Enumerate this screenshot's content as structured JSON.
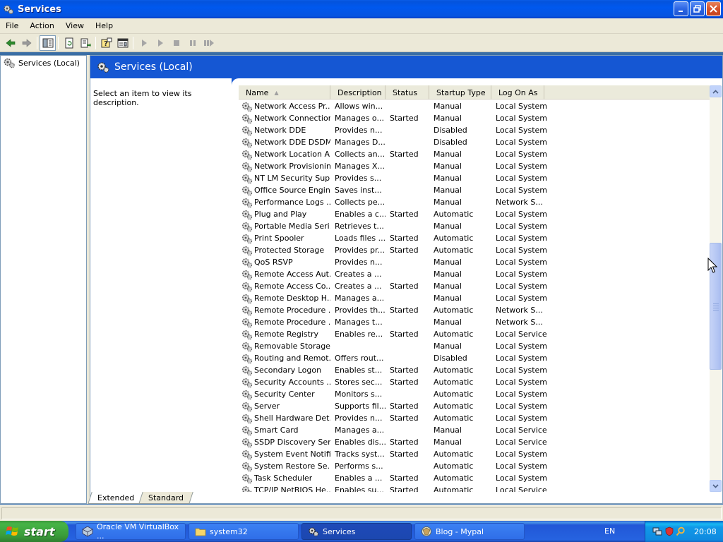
{
  "window": {
    "title": "Services"
  },
  "menu": [
    "File",
    "Action",
    "View",
    "Help"
  ],
  "tree": {
    "root_label": "Services (Local)"
  },
  "header": {
    "title": "Services (Local)"
  },
  "description_prompt": "Select an item to view its description.",
  "columns": {
    "name": "Name",
    "description": "Description",
    "status": "Status",
    "startup": "Startup Type",
    "logon": "Log On As"
  },
  "services": [
    {
      "name": "Network Access Pr...",
      "desc": "Allows win...",
      "status": "",
      "startup": "Manual",
      "logon": "Local System"
    },
    {
      "name": "Network Connections",
      "desc": "Manages o...",
      "status": "Started",
      "startup": "Manual",
      "logon": "Local System"
    },
    {
      "name": "Network DDE",
      "desc": "Provides n...",
      "status": "",
      "startup": "Disabled",
      "logon": "Local System"
    },
    {
      "name": "Network DDE DSDM",
      "desc": "Manages D...",
      "status": "",
      "startup": "Disabled",
      "logon": "Local System"
    },
    {
      "name": "Network Location A...",
      "desc": "Collects an...",
      "status": "Started",
      "startup": "Manual",
      "logon": "Local System"
    },
    {
      "name": "Network Provisionin...",
      "desc": "Manages X...",
      "status": "",
      "startup": "Manual",
      "logon": "Local System"
    },
    {
      "name": "NT LM Security Sup...",
      "desc": "Provides s...",
      "status": "",
      "startup": "Manual",
      "logon": "Local System"
    },
    {
      "name": "Office Source Engine",
      "desc": "Saves inst...",
      "status": "",
      "startup": "Manual",
      "logon": "Local System"
    },
    {
      "name": "Performance Logs ...",
      "desc": "Collects pe...",
      "status": "",
      "startup": "Manual",
      "logon": "Network S..."
    },
    {
      "name": "Plug and Play",
      "desc": "Enables a c...",
      "status": "Started",
      "startup": "Automatic",
      "logon": "Local System"
    },
    {
      "name": "Portable Media Seri...",
      "desc": "Retrieves t...",
      "status": "",
      "startup": "Manual",
      "logon": "Local System"
    },
    {
      "name": "Print Spooler",
      "desc": "Loads files ...",
      "status": "Started",
      "startup": "Automatic",
      "logon": "Local System"
    },
    {
      "name": "Protected Storage",
      "desc": "Provides pr...",
      "status": "Started",
      "startup": "Automatic",
      "logon": "Local System"
    },
    {
      "name": "QoS RSVP",
      "desc": "Provides n...",
      "status": "",
      "startup": "Manual",
      "logon": "Local System"
    },
    {
      "name": "Remote Access Aut...",
      "desc": "Creates a ...",
      "status": "",
      "startup": "Manual",
      "logon": "Local System"
    },
    {
      "name": "Remote Access Co...",
      "desc": "Creates a ...",
      "status": "Started",
      "startup": "Manual",
      "logon": "Local System"
    },
    {
      "name": "Remote Desktop H...",
      "desc": "Manages a...",
      "status": "",
      "startup": "Manual",
      "logon": "Local System"
    },
    {
      "name": "Remote Procedure ...",
      "desc": "Provides th...",
      "status": "Started",
      "startup": "Automatic",
      "logon": "Network S..."
    },
    {
      "name": "Remote Procedure ...",
      "desc": "Manages t...",
      "status": "",
      "startup": "Manual",
      "logon": "Network S..."
    },
    {
      "name": "Remote Registry",
      "desc": "Enables re...",
      "status": "Started",
      "startup": "Automatic",
      "logon": "Local Service"
    },
    {
      "name": "Removable Storage",
      "desc": "",
      "status": "",
      "startup": "Manual",
      "logon": "Local System"
    },
    {
      "name": "Routing and Remot...",
      "desc": "Offers rout...",
      "status": "",
      "startup": "Disabled",
      "logon": "Local System"
    },
    {
      "name": "Secondary Logon",
      "desc": "Enables st...",
      "status": "Started",
      "startup": "Automatic",
      "logon": "Local System"
    },
    {
      "name": "Security Accounts ...",
      "desc": "Stores sec...",
      "status": "Started",
      "startup": "Automatic",
      "logon": "Local System"
    },
    {
      "name": "Security Center",
      "desc": "Monitors s...",
      "status": "",
      "startup": "Automatic",
      "logon": "Local System"
    },
    {
      "name": "Server",
      "desc": "Supports fil...",
      "status": "Started",
      "startup": "Automatic",
      "logon": "Local System"
    },
    {
      "name": "Shell Hardware Det...",
      "desc": "Provides n...",
      "status": "Started",
      "startup": "Automatic",
      "logon": "Local System"
    },
    {
      "name": "Smart Card",
      "desc": "Manages a...",
      "status": "",
      "startup": "Manual",
      "logon": "Local Service"
    },
    {
      "name": "SSDP Discovery Ser...",
      "desc": "Enables dis...",
      "status": "Started",
      "startup": "Manual",
      "logon": "Local Service"
    },
    {
      "name": "System Event Notifi...",
      "desc": "Tracks syst...",
      "status": "Started",
      "startup": "Automatic",
      "logon": "Local System"
    },
    {
      "name": "System Restore Se...",
      "desc": "Performs s...",
      "status": "",
      "startup": "Automatic",
      "logon": "Local System"
    },
    {
      "name": "Task Scheduler",
      "desc": "Enables a ...",
      "status": "Started",
      "startup": "Automatic",
      "logon": "Local System"
    },
    {
      "name": "TCP/IP NetBIOS He...",
      "desc": "Enables su...",
      "status": "Started",
      "startup": "Automatic",
      "logon": "Local Service"
    }
  ],
  "tabs": {
    "extended": "Extended",
    "standard": "Standard"
  },
  "taskbar": {
    "start_label": "start",
    "tasks": [
      "Oracle VM VirtualBox ...",
      "system32",
      "Services",
      "Blog - Mypal"
    ],
    "language": "EN",
    "clock": "20:08"
  },
  "colors": {
    "title_bar": "#0058ee",
    "header_band": "#1557d3",
    "taskbar": "#2663e0",
    "start_button": "#3a9c3a",
    "tray": "#0f8ae0"
  },
  "icons": [
    "services-gear-icon",
    "back-arrow-icon",
    "forward-arrow-icon",
    "show-tree-icon",
    "refresh-icon",
    "export-list-icon",
    "help-icon",
    "properties-icon",
    "play-icon",
    "pause-icon",
    "stop-icon",
    "restart-icon",
    "windows-flag-icon"
  ]
}
